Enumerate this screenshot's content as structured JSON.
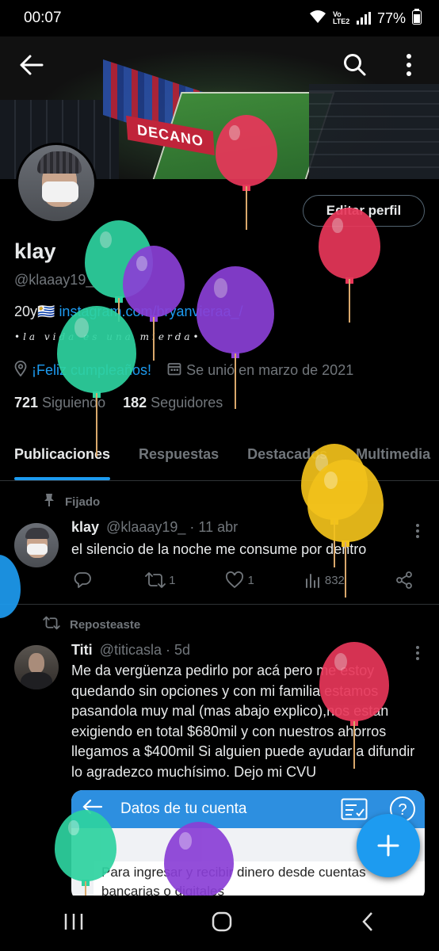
{
  "status": {
    "time": "00:07",
    "network": "Vo LTE2",
    "battery": "77%"
  },
  "banner": {
    "stadium_text": "DECANO"
  },
  "profile": {
    "edit_label": "Editar perfil",
    "name": "klay",
    "handle": "@klaaay19_",
    "bio_prefix": "20y🇺🇾 ",
    "bio_link": "instagram.com/bryanvieraa_/",
    "bio_line2": "•la vida es una mierda•",
    "birthday": "¡Feliz cumpleaños!",
    "joined": "Se unió en marzo de 2021",
    "following_count": "721",
    "following_label": "Siguiendo",
    "followers_count": "182",
    "followers_label": "Seguidores"
  },
  "tabs": [
    {
      "label": "Publicaciones",
      "active": true
    },
    {
      "label": "Respuestas",
      "active": false
    },
    {
      "label": "Destacados",
      "active": false
    },
    {
      "label": "Multimedia",
      "active": false
    }
  ],
  "posts": [
    {
      "context": "Fijado",
      "author": "klay",
      "handle": "@klaaay19_",
      "time": "· 11 abr",
      "text": "el silencio de la noche me consume por dentro",
      "replies": "",
      "reposts": "1",
      "likes": "1",
      "views": "832"
    },
    {
      "context": "Reposteaste",
      "author": "Titi",
      "handle": "@titicasla",
      "time": "· 5d",
      "text": "Me da vergüenza pedirlo por acá pero me estoy quedando sin opciones y con mi familia estamos pasandola muy mal (mas abajo explico),nos estan exigiendo en total $680mil y con nuestros ahorros llegamos a $400mil Si alguien puede ayudar a difundir lo agradezco muchísimo. Dejo mi CVU"
    }
  ],
  "card": {
    "title": "Datos de tu cuenta",
    "body": "Para ingresar y recibir dinero desde cuentas bancarias o digitales"
  },
  "colors": {
    "accent": "#1d9bf0",
    "muted": "#71767b",
    "text": "#e7e9ea",
    "background": "#000000"
  }
}
